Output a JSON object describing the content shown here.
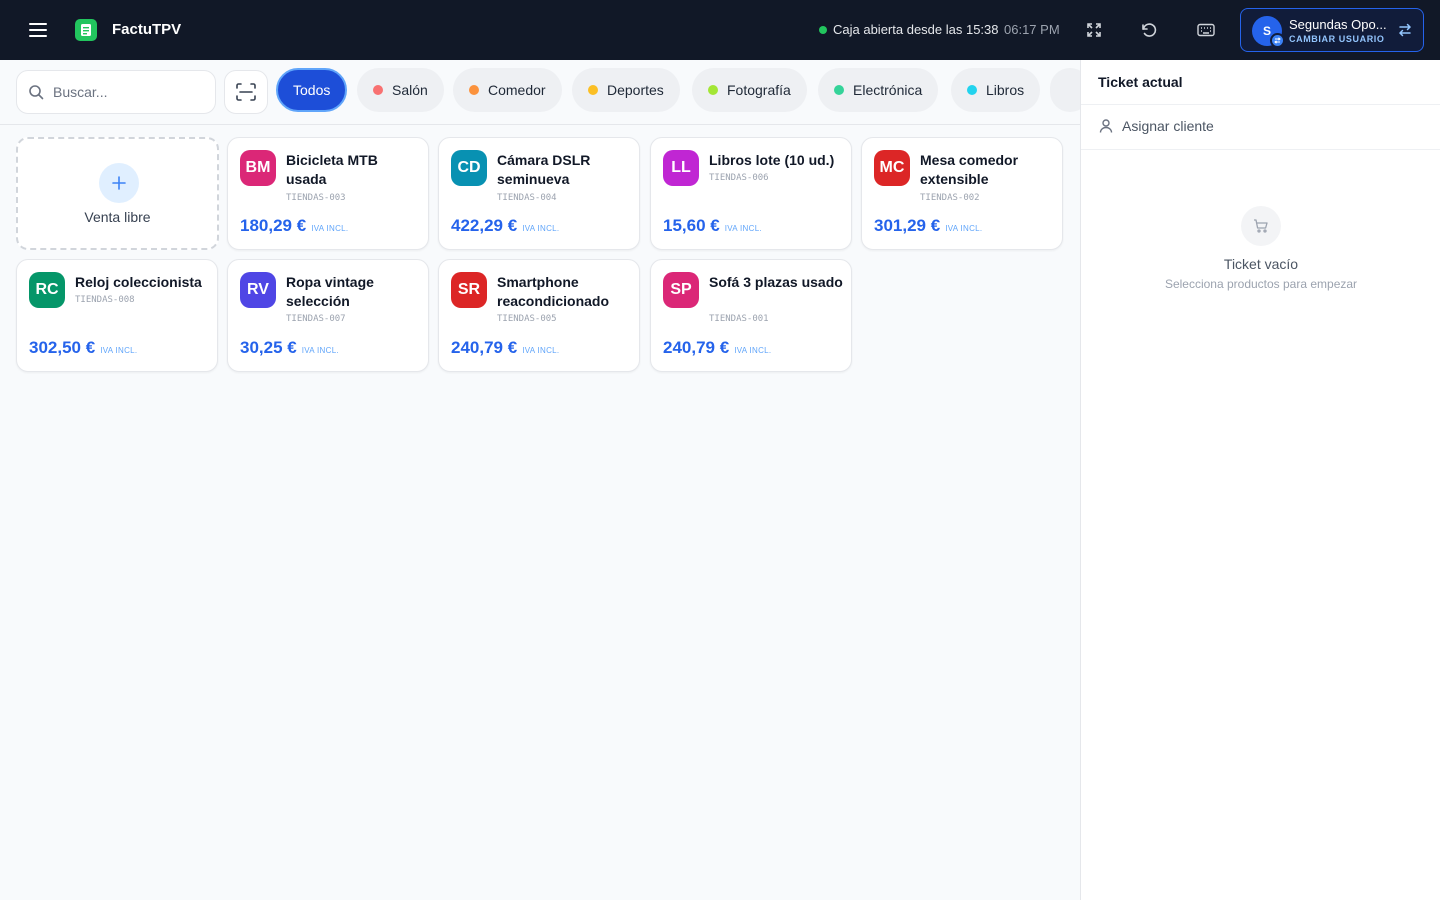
{
  "header": {
    "app_title": "FactuTPV",
    "caja_status": "Caja abierta desde las 15:38",
    "time": "06:17 PM",
    "user": {
      "initial": "S",
      "name": "Segundas Opo...",
      "action": "CAMBIAR USUARIO"
    }
  },
  "search": {
    "placeholder": "Buscar...",
    "value": ""
  },
  "categories": [
    {
      "label": "Todos",
      "active": true
    },
    {
      "label": "Salón",
      "color": "#f87171"
    },
    {
      "label": "Comedor",
      "color": "#fb923c"
    },
    {
      "label": "Deportes",
      "color": "#fbbf24"
    },
    {
      "label": "Fotografía",
      "color": "#a3e635"
    },
    {
      "label": "Electrónica",
      "color": "#34d399"
    },
    {
      "label": "Libros",
      "color": "#22d3ee"
    }
  ],
  "free_sale": {
    "label": "Venta libre"
  },
  "iva_label": "IVA INCL.",
  "products": [
    {
      "abbr": "BM",
      "name": "Bicicleta MTB usada",
      "sku": "TIENDAS-003",
      "price": "180,29 €",
      "color": "#db2777"
    },
    {
      "abbr": "CD",
      "name": "Cámara DSLR seminueva",
      "sku": "TIENDAS-004",
      "price": "422,29 €",
      "color": "#0891b2"
    },
    {
      "abbr": "LL",
      "name": "Libros lote (10 ud.)",
      "sku": "TIENDAS-006",
      "price": "15,60 €",
      "color": "#c026d3"
    },
    {
      "abbr": "MC",
      "name": "Mesa comedor extensible",
      "sku": "TIENDAS-002",
      "price": "301,29 €",
      "color": "#dc2626"
    },
    {
      "abbr": "RC",
      "name": "Reloj coleccionista",
      "sku": "TIENDAS-008",
      "price": "302,50 €",
      "color": "#059669"
    },
    {
      "abbr": "RV",
      "name": "Ropa vintage selección",
      "sku": "TIENDAS-007",
      "price": "30,25 €",
      "color": "#4f46e5"
    },
    {
      "abbr": "SR",
      "name": "Smartphone reacondicionado",
      "sku": "TIENDAS-005",
      "price": "240,79 €",
      "color": "#dc2626"
    },
    {
      "abbr": "SP",
      "name": "Sofá 3 plazas usado",
      "sku": "TIENDAS-001",
      "price": "240,79 €",
      "color": "#db2777"
    }
  ],
  "ticket": {
    "title": "Ticket actual",
    "assign_client": "Asignar cliente",
    "empty_title": "Ticket vacío",
    "empty_sub": "Selecciona productos para empezar"
  }
}
